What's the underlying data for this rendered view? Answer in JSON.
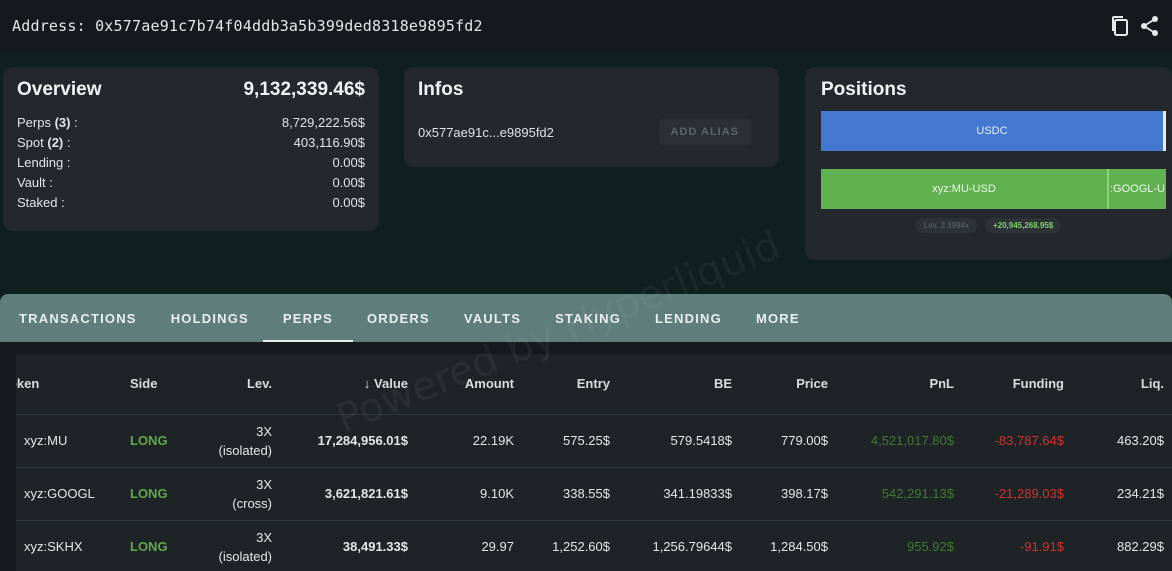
{
  "topbar": {
    "address_text": "Address: 0x577ae91c7b74f04ddb3a5b399ded8318e9895fd2",
    "copy_icon": "copy-icon",
    "share_icon": "share-icon"
  },
  "overview": {
    "title": "Overview",
    "total": "9,132,339.46$",
    "rows": [
      {
        "label": "Perps ",
        "count": "(3)",
        "suffix": " :",
        "value": "8,729,222.56$"
      },
      {
        "label": "Spot ",
        "count": "(2)",
        "suffix": " :",
        "value": "403,116.90$"
      },
      {
        "label": "Lending",
        "count": "",
        "suffix": " :",
        "value": "0.00$"
      },
      {
        "label": "Vault",
        "count": "",
        "suffix": " :",
        "value": "0.00$"
      },
      {
        "label": "Staked",
        "count": "",
        "suffix": " :",
        "value": "0.00$"
      }
    ]
  },
  "infos": {
    "title": "Infos",
    "short_address": "0x577ae91c...e9895fd2",
    "alias_button": "ADD ALIAS"
  },
  "positions": {
    "title": "Positions",
    "spot_bar_label": "USDC",
    "perp_segments": [
      {
        "label": "xyz:MU-USD",
        "share": 0.83
      },
      {
        "label": ":GOOGL-U",
        "share": 0.17
      }
    ],
    "liq_chip": "Lev. 2.3994x",
    "pnl_chip": "+20,945,268.95$"
  },
  "tabs": [
    "TRANSACTIONS",
    "HOLDINGS",
    "PERPS",
    "ORDERS",
    "VAULTS",
    "STAKING",
    "LENDING",
    "MORE"
  ],
  "active_tab": "PERPS",
  "table": {
    "headers": {
      "token": "Token",
      "side": "Side",
      "lev": "Lev.",
      "value": "Value",
      "amount": "Amount",
      "entry": "Entry",
      "be": "BE",
      "price": "Price",
      "pnl": "PnL",
      "funding": "Funding",
      "liq": "Liq."
    },
    "rows": [
      {
        "token": "xyz:MU",
        "side": "LONG",
        "lev1": "3X",
        "lev2": "(isolated)",
        "value": "17,284,956.01$",
        "amount": "22.19K",
        "entry": "575.25$",
        "be": "579.5418$",
        "price": "779.00$",
        "pnl": "4,521,017.80$",
        "funding": "-83,787.64$",
        "liq": "463.20$"
      },
      {
        "token": "xyz:GOOGL",
        "side": "LONG",
        "lev1": "3X",
        "lev2": "(cross)",
        "value": "3,621,821.61$",
        "amount": "9.10K",
        "entry": "338.55$",
        "be": "341.19833$",
        "price": "398.17$",
        "pnl": "542,291.13$",
        "funding": "-21,289.03$",
        "liq": "234.21$"
      },
      {
        "token": "xyz:SKHX",
        "side": "LONG",
        "lev1": "3X",
        "lev2": "(isolated)",
        "value": "38,491.33$",
        "amount": "29.97",
        "entry": "1,252.60$",
        "be": "1,256.79644$",
        "price": "1,284.50$",
        "pnl": "955.92$",
        "funding": "-91.91$",
        "liq": "882.29$"
      }
    ]
  },
  "watermark": "Powered by Hyperliquid",
  "colors": {
    "long": "#5fa84b",
    "negative": "#d0332f",
    "usdc_bar": "#4478d0",
    "perp_bar": "#5fb24f",
    "tabbar": "#5f7d7a"
  }
}
